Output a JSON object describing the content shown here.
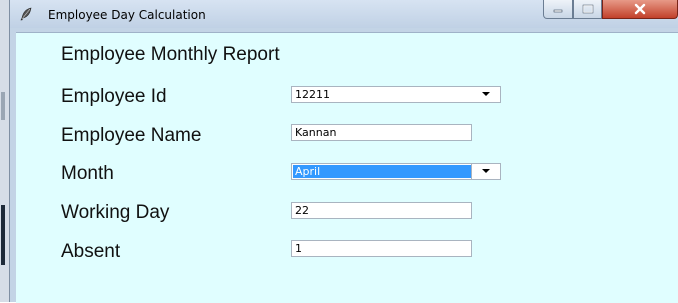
{
  "window": {
    "title": "Employee Day Calculation"
  },
  "report": {
    "title": "Employee Monthly Report"
  },
  "fields": {
    "employee_id": {
      "label": "Employee Id",
      "value": "12211"
    },
    "employee_name": {
      "label": "Employee Name",
      "value": "Kannan"
    },
    "month": {
      "label": "Month",
      "value": "April"
    },
    "working_day": {
      "label": "Working Day",
      "value": "22"
    },
    "absent": {
      "label": "Absent",
      "value": "1"
    }
  },
  "icons": {
    "app": "feather-icon",
    "minimize": "minimize-icon",
    "maximize": "maximize-icon",
    "close": "close-icon",
    "dropdown": "chevron-down-icon"
  },
  "colors": {
    "client_background": "#e0feff",
    "selection": "#3399ff",
    "close_button": "#c2412b"
  }
}
